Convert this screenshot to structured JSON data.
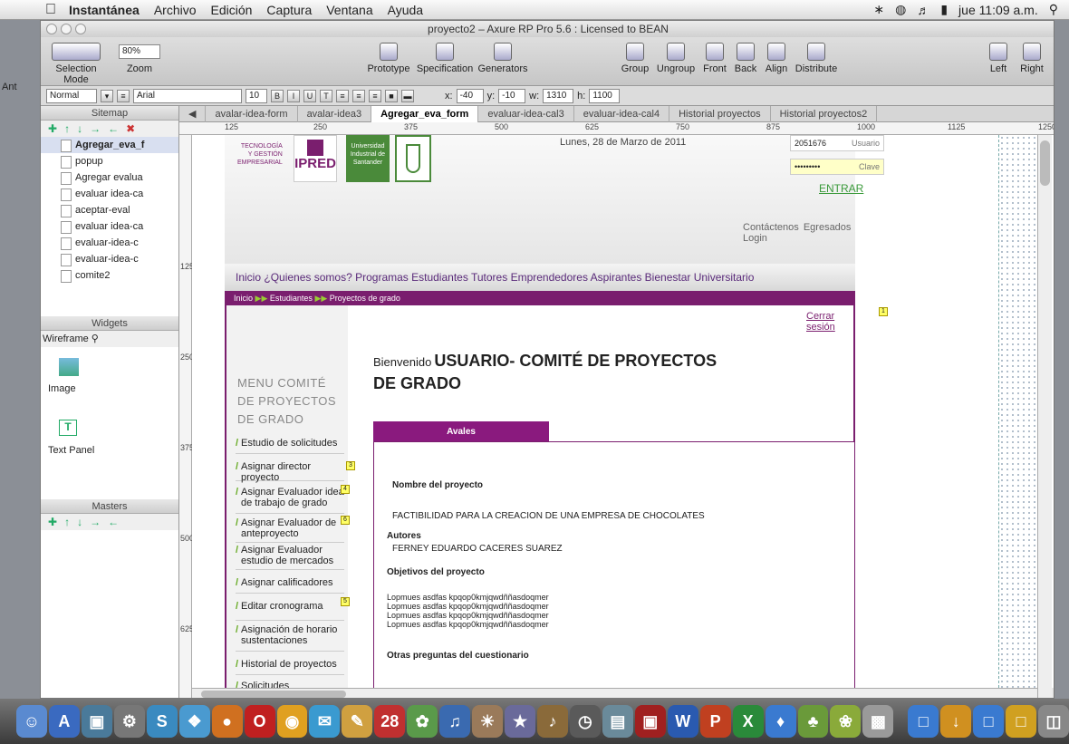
{
  "menubar": {
    "app": "Instantánea",
    "menus": [
      "Archivo",
      "Edición",
      "Captura",
      "Ventana",
      "Ayuda"
    ],
    "clock": "jue 11:09 a.m."
  },
  "window": {
    "title": "proyecto2 – Axure RP Pro 5.6 : Licensed to BEAN"
  },
  "toolbar": {
    "selection_mode": "Selection Mode",
    "zoom_label": "Zoom",
    "zoom_value": "80%",
    "prototype": "Prototype",
    "specification": "Specification",
    "generators": "Generators",
    "group": "Group",
    "ungroup": "Ungroup",
    "front": "Front",
    "back": "Back",
    "align": "Align",
    "distribute": "Distribute",
    "left": "Left",
    "right": "Right",
    "cut_label": "Ant"
  },
  "format": {
    "style": "Normal",
    "font": "Arial",
    "size": "10",
    "x_label": "x:",
    "x": "-40",
    "y_label": "y:",
    "y": "-10",
    "w_label": "w:",
    "w": "1310",
    "h_label": "h:",
    "h": "1100"
  },
  "sitemap": {
    "title": "Sitemap",
    "items": [
      "Agregar_eva_f",
      "popup",
      "Agregar evalua",
      "evaluar idea-ca",
      "aceptar-eval",
      "evaluar idea-ca",
      "evaluar-idea-c",
      "evaluar-idea-c",
      "comite2"
    ]
  },
  "widgets": {
    "title": "Widgets",
    "filter": "Wireframe",
    "items": [
      "Image",
      "Text Panel"
    ]
  },
  "masters": {
    "title": "Masters"
  },
  "tabs": [
    "avalar-idea-form",
    "avalar-idea3",
    "Agregar_eva_form",
    "evaluar-idea-cal3",
    "evaluar-idea-cal4",
    "Historial proyectos",
    "Historial proyectos2"
  ],
  "ruler": {
    "h": [
      "125",
      "250",
      "375",
      "500",
      "625",
      "750",
      "875",
      "1000",
      "1125",
      "1250"
    ],
    "v": [
      "125",
      "250",
      "375",
      "500",
      "625"
    ]
  },
  "page": {
    "logo_text_1": "TECNOLOGÍA",
    "logo_text_2": "Y GESTIÓN",
    "logo_text_3": "EMPRESARIAL",
    "ipred": "IPRED",
    "uis_1": "Universidad",
    "uis_2": "Industrial de",
    "uis_3": "Santander",
    "date": "Lunes, 28 de Marzo de 2011",
    "user_value": "2051676",
    "user_label": "Usuario",
    "pass_value": "•••••••••",
    "pass_label": "Clave",
    "enter": "ENTRAR",
    "links": [
      "Contáctenos",
      "Egresados",
      "Login"
    ],
    "nav": [
      "Inicio",
      "¿Quienes somos?",
      "Programas",
      "Estudiantes",
      "Tutores",
      "Emprendedores",
      "Aspirantes",
      "Bienestar Universitario"
    ],
    "crumb": [
      "Inicio",
      "Estudiantes",
      "Proyectos de grado"
    ],
    "logout": "Cerrar sesión",
    "welcome_small": "Bienvenido",
    "welcome_big": "USUARIO- COMITÉ DE PROYECTOS",
    "welcome_big2": "DE GRADO",
    "menu_title": "MENU COMITÉ DE PROYECTOS DE GRADO",
    "menu": [
      "Estudio de solicitudes",
      "Asignar director proyecto",
      "Asignar Evaluador idea de trabajo de grado",
      "Asignar Evaluador de anteproyecto",
      "Asignar Evaluador estudio de mercados",
      "Asignar calificadores",
      "Editar cronograma",
      "Asignación de horario sustentaciones",
      "Historial de proyectos",
      "Solicitudes"
    ],
    "notes": [
      "1",
      "3",
      "4",
      "6",
      "5"
    ],
    "tab": "Avales",
    "name_label": "Nombre del proyecto",
    "name_value": "FACTIBILIDAD PARA LA CREACION DE UNA EMPRESA DE CHOCOLATES",
    "authors_label": "Autores",
    "authors_value": "FERNEY EDUARDO CACERES SUAREZ",
    "objectives_label": "Objetivos del proyecto",
    "objective_line": "Lopmues asdfas kpqop0kmjqwdññasdoqmer",
    "other_label": "Otras preguntas del cuestionario"
  }
}
